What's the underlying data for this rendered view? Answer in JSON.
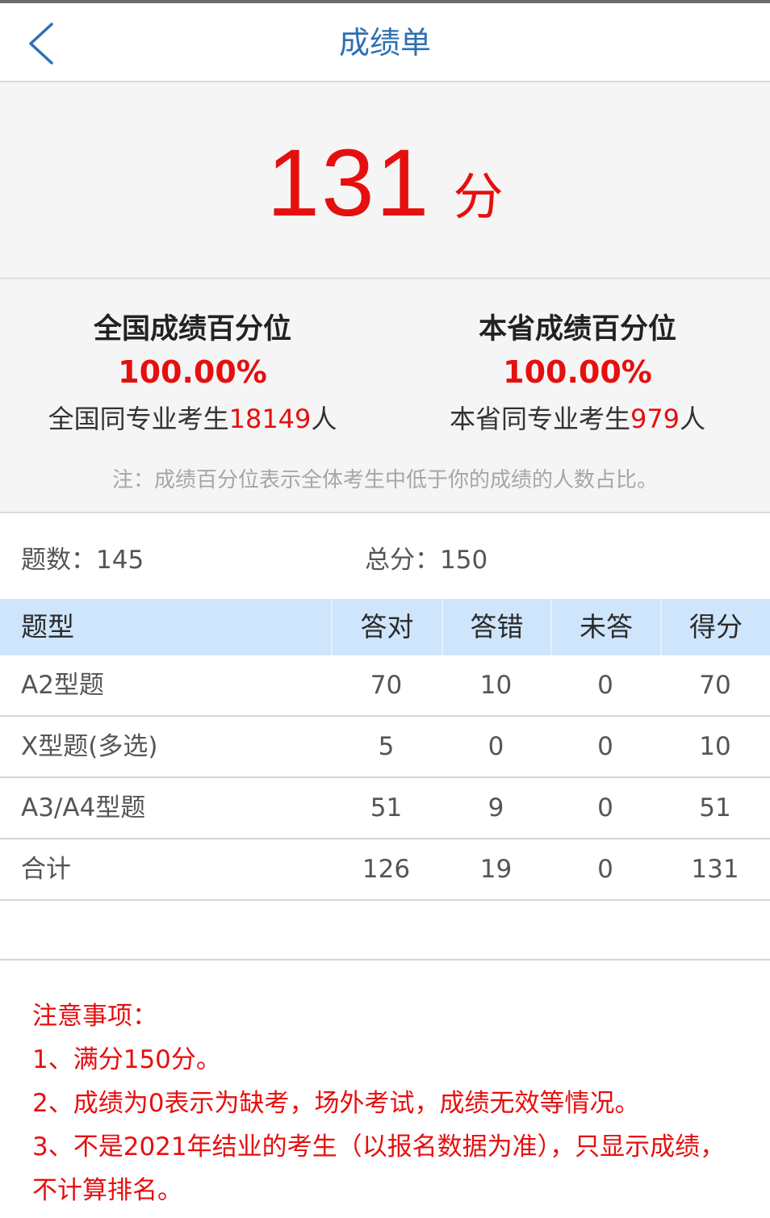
{
  "nav": {
    "title": "成绩单"
  },
  "score": {
    "value": "131",
    "unit": "分"
  },
  "percentile": {
    "national": {
      "title": "全国成绩百分位",
      "value": "100.00%",
      "count_prefix": "全国同专业考生",
      "count": "18149",
      "count_suffix": "人"
    },
    "provincial": {
      "title": "本省成绩百分位",
      "value": "100.00%",
      "count_prefix": "本省同专业考生",
      "count": "979",
      "count_suffix": "人"
    },
    "note": "注：成绩百分位表示全体考生中低于你的成绩的人数占比。"
  },
  "summary": {
    "questions": "题数：145",
    "total": "总分：150"
  },
  "table": {
    "headers": [
      "题型",
      "答对",
      "答错",
      "未答",
      "得分"
    ],
    "rows": [
      [
        "A2型题",
        "70",
        "10",
        "0",
        "70"
      ],
      [
        "X型题(多选)",
        "5",
        "0",
        "0",
        "10"
      ],
      [
        "A3/A4型题",
        "51",
        "9",
        "0",
        "51"
      ],
      [
        "合计",
        "126",
        "19",
        "0",
        "131"
      ]
    ]
  },
  "notes": {
    "title": "注意事项：",
    "items": [
      "1、满分150分。",
      "2、成绩为0表示为缺考，场外考试，成绩无效等情况。",
      "3、不是2021年结业的考生（以报名数据为准），只显示成绩，不计算排名。"
    ]
  },
  "colors": {
    "accent_red": "#e60f0f",
    "title_blue": "#2f6fb3",
    "header_blue": "#cfe5fb"
  }
}
